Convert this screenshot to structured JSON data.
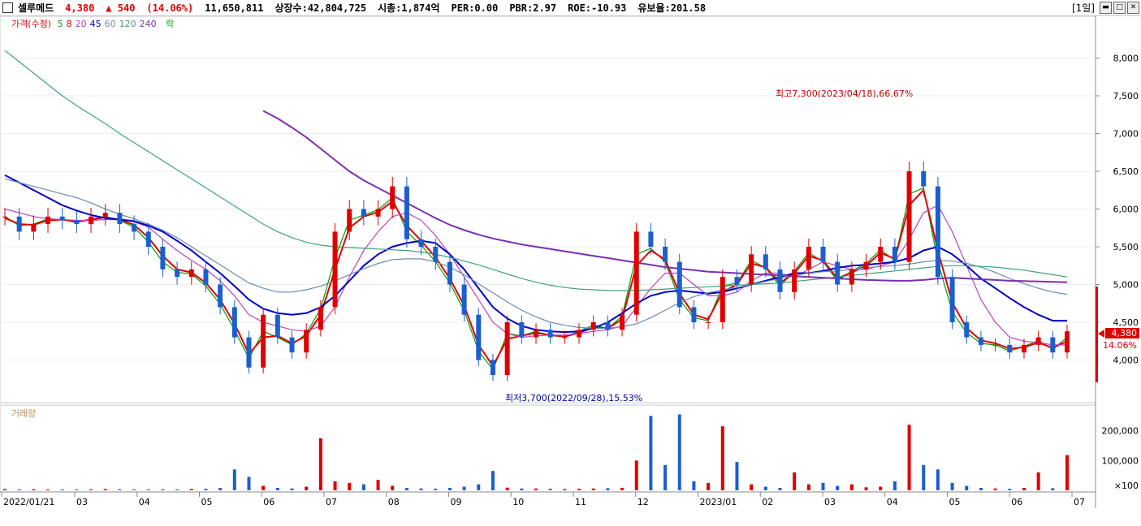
{
  "header": {
    "name": "셀루메드",
    "price": "4,380",
    "change": "▲ 540",
    "change_pct": "(14.06%)",
    "volume": "11,650,811",
    "shares": "상장수:42,804,725",
    "mcap": "시총:1,874억",
    "per": "PER:0.00",
    "pbr": "PBR:2.97",
    "roe": "ROE:-10.93",
    "float": "유보율:201.58",
    "period": "[1일]"
  },
  "legend": {
    "price": "가격(수정)",
    "ma": [
      {
        "label": "5",
        "color": "#00a000"
      },
      {
        "label": "8",
        "color": "#e00000"
      },
      {
        "label": "20",
        "color": "#c040c0"
      },
      {
        "label": "45",
        "color": "#0000c8"
      },
      {
        "label": "60",
        "color": "#6a8cb0"
      },
      {
        "label": "120",
        "color": "#40a080"
      },
      {
        "label": "240",
        "color": "#7a30b0"
      }
    ],
    "extra": "락",
    "volume": "거래량"
  },
  "annotations": {
    "high": "최고7,300(2023/04/18),66.67%",
    "low": "최저3,700(2022/09/28),15.53%",
    "last_price": "4,380",
    "last_pct": "14.06%"
  },
  "chart_data": [
    {
      "type": "candlestick",
      "x_labels": [
        "2022/01/21",
        "03",
        "04",
        "05",
        "06",
        "07",
        "08",
        "09",
        "10",
        "11",
        "12",
        "2023/01",
        "02",
        "03",
        "04",
        "05",
        "06",
        "07"
      ],
      "ylim": [
        3500,
        8500
      ],
      "y_ticks": [
        "8,000",
        "7,500",
        "7,000",
        "6,500",
        "6,000",
        "5,500",
        "5,000",
        "4,500",
        "4,000"
      ],
      "close": [
        5900,
        5700,
        5800,
        5900,
        5850,
        5800,
        5900,
        5950,
        5800,
        5700,
        5500,
        5200,
        5100,
        5200,
        5000,
        4700,
        4300,
        3900,
        4600,
        4300,
        4100,
        4400,
        4700,
        5700,
        6000,
        5900,
        6000,
        6300,
        5600,
        5500,
        5300,
        5000,
        4600,
        4000,
        3800,
        4500,
        4300,
        4400,
        4300,
        4300,
        4400,
        4500,
        4400,
        4600,
        5700,
        5500,
        5300,
        4700,
        4500,
        4500,
        5100,
        5000,
        5400,
        5200,
        4900,
        5200,
        5500,
        5300,
        5000,
        5200,
        5300,
        5500,
        5300,
        6500,
        6300,
        5100,
        4500,
        4300,
        4200,
        4200,
        4100,
        4200,
        4300,
        4100,
        4380
      ],
      "series": [
        {
          "name": "5",
          "values": [
            5900,
            5780,
            5800,
            5870,
            5860,
            5820,
            5870,
            5900,
            5850,
            5760,
            5560,
            5300,
            5160,
            5140,
            4980,
            4740,
            4400,
            4020,
            4380,
            4300,
            4200,
            4350,
            4680,
            5350,
            5850,
            5920,
            5990,
            6150,
            5700,
            5520,
            5300,
            5020,
            4650,
            4120,
            3870,
            4350,
            4320,
            4380,
            4320,
            4310,
            4380,
            4460,
            4420,
            4580,
            5400,
            5480,
            5300,
            4800,
            4560,
            4520,
            4980,
            5020,
            5320,
            5220,
            4980,
            5180,
            5420,
            5300,
            5050,
            5180,
            5280,
            5460,
            5320,
            6200,
            6280,
            5300,
            4640,
            4360,
            4220,
            4200,
            4120,
            4180,
            4260,
            4140,
            4300
          ]
        },
        {
          "name": "8",
          "values": [
            5880,
            5800,
            5790,
            5850,
            5860,
            5830,
            5860,
            5890,
            5860,
            5790,
            5620,
            5380,
            5200,
            5160,
            5020,
            4800,
            4480,
            4080,
            4300,
            4320,
            4220,
            4320,
            4600,
            5200,
            5750,
            5900,
            5960,
            6100,
            5780,
            5580,
            5360,
            5080,
            4720,
            4200,
            3920,
            4280,
            4320,
            4360,
            4330,
            4310,
            4360,
            4430,
            4420,
            4540,
            5250,
            5450,
            5330,
            4880,
            4600,
            4540,
            4900,
            5000,
            5280,
            5230,
            5020,
            5150,
            5380,
            5320,
            5080,
            5160,
            5250,
            5420,
            5340,
            6050,
            6250,
            5450,
            4760,
            4420,
            4260,
            4220,
            4150,
            4170,
            4230,
            4160,
            4250
          ]
        },
        {
          "name": "20",
          "values": [
            6000,
            5950,
            5900,
            5870,
            5860,
            5850,
            5850,
            5860,
            5860,
            5830,
            5760,
            5600,
            5450,
            5320,
            5200,
            5050,
            4850,
            4600,
            4500,
            4450,
            4400,
            4380,
            4450,
            4700,
            5100,
            5450,
            5700,
            5900,
            5950,
            5850,
            5650,
            5400,
            5100,
            4800,
            4500,
            4350,
            4300,
            4320,
            4330,
            4330,
            4350,
            4380,
            4400,
            4450,
            4700,
            4950,
            5150,
            5150,
            5000,
            4850,
            4850,
            4900,
            5050,
            5150,
            5150,
            5100,
            5200,
            5300,
            5250,
            5200,
            5200,
            5250,
            5300,
            5600,
            5950,
            6050,
            5700,
            5250,
            4800,
            4500,
            4300,
            4250,
            4230,
            4200,
            4200
          ]
        },
        {
          "name": "45",
          "values": [
            6450,
            6350,
            6250,
            6150,
            6050,
            5980,
            5920,
            5880,
            5860,
            5840,
            5780,
            5700,
            5580,
            5450,
            5300,
            5150,
            4980,
            4800,
            4680,
            4620,
            4600,
            4620,
            4700,
            4850,
            5050,
            5250,
            5400,
            5500,
            5550,
            5580,
            5550,
            5400,
            5200,
            4950,
            4700,
            4550,
            4450,
            4400,
            4380,
            4370,
            4380,
            4420,
            4500,
            4620,
            4750,
            4850,
            4900,
            4920,
            4900,
            4880,
            4900,
            4950,
            5000,
            5050,
            5100,
            5150,
            5150,
            5180,
            5220,
            5250,
            5260,
            5280,
            5300,
            5350,
            5450,
            5500,
            5400,
            5250,
            5080,
            4950,
            4820,
            4700,
            4600,
            4520,
            4520
          ]
        },
        {
          "name": "60",
          "values": [
            6400,
            6350,
            6300,
            6250,
            6200,
            6150,
            6080,
            6000,
            5930,
            5870,
            5800,
            5720,
            5620,
            5500,
            5380,
            5260,
            5140,
            5020,
            4950,
            4900,
            4900,
            4930,
            4980,
            5050,
            5130,
            5210,
            5280,
            5330,
            5340,
            5340,
            5300,
            5230,
            5130,
            5010,
            4890,
            4770,
            4660,
            4570,
            4500,
            4460,
            4430,
            4420,
            4420,
            4440,
            4480,
            4560,
            4660,
            4760,
            4840,
            4890,
            4930,
            4960,
            5000,
            5040,
            5080,
            5120,
            5150,
            5170,
            5180,
            5200,
            5220,
            5240,
            5250,
            5270,
            5300,
            5320,
            5310,
            5280,
            5230,
            5160,
            5080,
            5010,
            4950,
            4900,
            4870
          ]
        },
        {
          "name": "120",
          "values": [
            8100,
            7950,
            7800,
            7650,
            7500,
            7370,
            7250,
            7130,
            7000,
            6880,
            6760,
            6640,
            6520,
            6400,
            6280,
            6160,
            6040,
            5920,
            5800,
            5700,
            5620,
            5560,
            5520,
            5500,
            5490,
            5480,
            5470,
            5460,
            5450,
            5430,
            5400,
            5360,
            5310,
            5260,
            5200,
            5140,
            5080,
            5030,
            4990,
            4960,
            4940,
            4930,
            4920,
            4920,
            4920,
            4930,
            4940,
            4950,
            4960,
            4970,
            4980,
            4990,
            5000,
            5010,
            5020,
            5040,
            5060,
            5080,
            5100,
            5120,
            5140,
            5160,
            5180,
            5200,
            5220,
            5240,
            5250,
            5250,
            5240,
            5230,
            5210,
            5190,
            5160,
            5130,
            5100
          ]
        },
        {
          "name": "240",
          "values": [
            null,
            null,
            null,
            null,
            null,
            null,
            null,
            null,
            null,
            null,
            null,
            null,
            null,
            null,
            null,
            null,
            null,
            null,
            7300,
            7200,
            7080,
            6950,
            6800,
            6650,
            6500,
            6380,
            6280,
            6180,
            6080,
            5980,
            5880,
            5790,
            5720,
            5660,
            5610,
            5570,
            5530,
            5500,
            5470,
            5440,
            5410,
            5380,
            5350,
            5320,
            5290,
            5260,
            5230,
            5210,
            5190,
            5170,
            5160,
            5150,
            5140,
            5130,
            5120,
            5110,
            5100,
            5090,
            5080,
            5070,
            5060,
            5055,
            5050,
            5050,
            5060,
            5080,
            5090,
            5080,
            5070,
            5060,
            5050,
            5045,
            5040,
            5035,
            5030
          ]
        }
      ]
    },
    {
      "type": "bar",
      "name": "거래량",
      "unit": "×100",
      "y_ticks": [
        "200,000",
        "100,000",
        "×100"
      ],
      "ylim": [
        0,
        270000
      ],
      "values": [
        4000,
        3000,
        3500,
        3000,
        2500,
        3000,
        3000,
        4000,
        3500,
        3000,
        3000,
        3500,
        3000,
        4000,
        5000,
        8000,
        70000,
        45000,
        15000,
        8000,
        6000,
        12000,
        175000,
        30000,
        25000,
        20000,
        35000,
        15000,
        8000,
        6000,
        5000,
        8000,
        12000,
        20000,
        65000,
        9000,
        6000,
        6000,
        5000,
        4000,
        5000,
        6000,
        7000,
        8000,
        100000,
        250000,
        85000,
        255000,
        30000,
        25000,
        215000,
        95000,
        20000,
        12000,
        8000,
        60000,
        20000,
        25000,
        15000,
        20000,
        10000,
        12000,
        30000,
        220000,
        85000,
        70000,
        25000,
        15000,
        8000,
        6000,
        5000,
        8000,
        60000,
        7000,
        118000
      ]
    }
  ]
}
